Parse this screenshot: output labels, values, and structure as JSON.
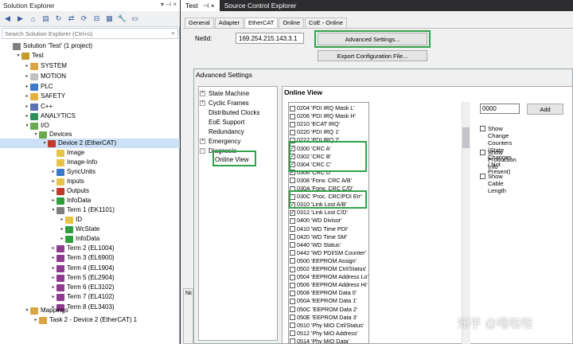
{
  "solution_explorer": {
    "title": "Solution Explorer",
    "search_placeholder": "Search Solution Explorer (Ctrl+ü)",
    "tree": [
      {
        "label": "Solution 'Test' (1 project)",
        "color": "#7f7f7f"
      },
      {
        "label": "Test",
        "color": "#c89a2c"
      },
      {
        "label": "SYSTEM",
        "color": "#d9a441"
      },
      {
        "label": "MOTION",
        "color": "#c0c0c0"
      },
      {
        "label": "PLC",
        "color": "#3a78c9"
      },
      {
        "label": "SAFETY",
        "color": "#e4b23a"
      },
      {
        "label": "C++",
        "color": "#5b6fb3"
      },
      {
        "label": "ANALYTICS",
        "color": "#2f8f5b"
      },
      {
        "label": "I/O",
        "color": "#6aa84f"
      },
      {
        "label": "Devices",
        "color": "#6aa84f"
      },
      {
        "label": "Device 2 (EtherCAT)",
        "color": "#c0392b"
      },
      {
        "label": "Image",
        "color": "#e8c34a"
      },
      {
        "label": "Image-Info",
        "color": "#e8c34a"
      },
      {
        "label": "SyncUnits",
        "color": "#3a78c9"
      },
      {
        "label": "Inputs",
        "color": "#e8c34a"
      },
      {
        "label": "Outputs",
        "color": "#c0392b"
      },
      {
        "label": "InfoData",
        "color": "#2e9e3e"
      },
      {
        "label": "Term 1 (EK1101)",
        "color": "#7f7f7f"
      },
      {
        "label": "ID",
        "color": "#e8c34a"
      },
      {
        "label": "WcState",
        "color": "#2e9e3e"
      },
      {
        "label": "InfoData",
        "color": "#2e9e3e"
      },
      {
        "label": "Term 2 (EL1004)",
        "color": "#8e3a8e"
      },
      {
        "label": "Term 3 (EL6900)",
        "color": "#8e3a8e"
      },
      {
        "label": "Term 4 (EL1904)",
        "color": "#8e3a8e"
      },
      {
        "label": "Term 5 (EL2904)",
        "color": "#8e3a8e"
      },
      {
        "label": "Term 6 (EL3102)",
        "color": "#8e3a8e"
      },
      {
        "label": "Term 7 (EL4102)",
        "color": "#8e3a8e"
      },
      {
        "label": "Term 8 (EL3403)",
        "color": "#8e3a8e"
      },
      {
        "label": "Mappings",
        "color": "#d9a441"
      },
      {
        "label": "Task 2 - Device 2 (EtherCAT) 1",
        "color": "#d9a441"
      }
    ]
  },
  "top_tabs": [
    {
      "label": "Test",
      "pin": "⊣ ×"
    },
    {
      "label": "Source Control Explorer"
    }
  ],
  "ethercat_tabs": [
    "General",
    "Adapter",
    "EtherCAT",
    "Online",
    "CoE - Online"
  ],
  "netid": {
    "label": "NetId:",
    "value": "169.254.215.143.3.1"
  },
  "buttons": {
    "advanced": "Advanced Settings...",
    "export": "Export Configuration File...",
    "add": "Add"
  },
  "advanced_settings": {
    "title": "Advanced Settings",
    "tree": [
      {
        "label": "State Machine",
        "expander": "+"
      },
      {
        "label": "Cyclic Frames",
        "expander": "+"
      },
      {
        "label": "Distributed Clocks",
        "expander": ""
      },
      {
        "label": "EoE Support",
        "expander": ""
      },
      {
        "label": "Redundancy",
        "expander": ""
      },
      {
        "label": "Emergency",
        "expander": "+"
      },
      {
        "label": "Diagnosis",
        "expander": "−"
      },
      {
        "label": "Online View",
        "expander": ""
      }
    ]
  },
  "online_view": {
    "title": "Online View",
    "value_input": "0000",
    "options": [
      {
        "label": "Show Change Counters",
        "sub": "(State Changes / Not Present)"
      },
      {
        "label": "Show Production Info",
        "sub": ""
      },
      {
        "label": "Show Cable Length",
        "sub": ""
      }
    ],
    "items": [
      {
        "label": "0204 'PDI IRQ Mask L'",
        "checked": false
      },
      {
        "label": "0206 'PDI IRQ Mask H'",
        "checked": false
      },
      {
        "label": "0210 'ECAT IRQ'",
        "checked": false
      },
      {
        "label": "0220 'PDI IRQ 1'",
        "checked": false
      },
      {
        "label": "0222 'PDI IRQ 2'",
        "checked": false
      },
      {
        "label": "0300 'CRC A'",
        "checked": true
      },
      {
        "label": "0302 'CRC B'",
        "checked": true
      },
      {
        "label": "0304 'CRC C'",
        "checked": true
      },
      {
        "label": "0306 'CRC D'",
        "checked": true
      },
      {
        "label": "0308 'Forw. CRC A/B'",
        "checked": false
      },
      {
        "label": "030A 'Forw. CRC C/D'",
        "checked": false
      },
      {
        "label": "030C 'Proc. CRC/PDI Err'",
        "checked": false
      },
      {
        "label": "0310 'Link Lost A/B'",
        "checked": true
      },
      {
        "label": "0312 'Link Lost C/D'",
        "checked": true
      },
      {
        "label": "0400 'WD Divisor'",
        "checked": false
      },
      {
        "label": "0410 'WD Time PDI'",
        "checked": false
      },
      {
        "label": "0420 'WD Time SM'",
        "checked": false
      },
      {
        "label": "0440 'WD Status'",
        "checked": false
      },
      {
        "label": "0442 'WD PDI/SM Counter'",
        "checked": false
      },
      {
        "label": "0500 'EEPROM Assign'",
        "checked": false
      },
      {
        "label": "0502 'EEPROM Ctrl/Status'",
        "checked": false
      },
      {
        "label": "0504 'EEPROM Address Lo'",
        "checked": false
      },
      {
        "label": "0506 'EEPROM Address Hi'",
        "checked": false
      },
      {
        "label": "0508 'EEPROM Data 0'",
        "checked": false
      },
      {
        "label": "050A 'EEPROM Data 1'",
        "checked": false
      },
      {
        "label": "050C 'EEPROM Data 2'",
        "checked": false
      },
      {
        "label": "050E 'EEPROM Data 3'",
        "checked": false
      },
      {
        "label": "0510 'Phy MIO Ctrl/Status'",
        "checked": false
      },
      {
        "label": "0512 'Phy MIO Address'",
        "checked": false
      },
      {
        "label": "0514 'Phy MIO Data'",
        "checked": false
      }
    ]
  },
  "side_strip": "Nε",
  "watermark": "知乎 @噜啦啦",
  "colors": {
    "highlight": "#31a24c",
    "selection": "#cce0f6"
  }
}
